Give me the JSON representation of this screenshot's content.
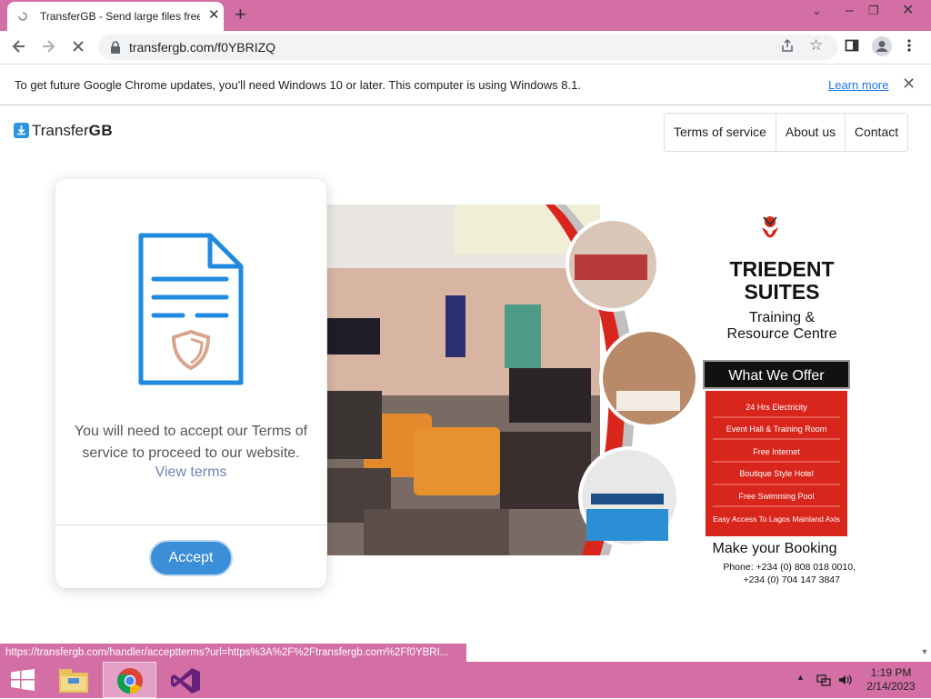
{
  "browser": {
    "tab_title": "TransferGB - Send large files free",
    "new_tab": "+",
    "url": "transfergb.com/f0YBRIZQ",
    "infobar_message": "To get future Google Chrome updates, you'll need Windows 10 or later. This computer is using Windows 8.1.",
    "infobar_link": "Learn more",
    "status_url": "https://transfergb.com/handler/acceptterms?url=https%3A%2F%2Ftransfergb.com%2Ff0YBRI..."
  },
  "site": {
    "logo_prefix": "Transfer",
    "logo_suffix": "GB",
    "nav": [
      "Terms of service",
      "About us",
      "Contact"
    ]
  },
  "terms_card": {
    "message": "You will need to accept our Terms of service to proceed to our website.",
    "view_link": "View terms",
    "accept_button": "Accept"
  },
  "ad": {
    "brand_line1": "TRIEDENT",
    "brand_line2": "SUITES",
    "subtitle_line1": "Training &",
    "subtitle_line2": "Resource Centre",
    "offer_title": "What We Offer",
    "offers": [
      "24 Hrs Electricity",
      "Event Hall & Training Room",
      "Free Internet",
      "Boutique Style Hotel",
      "Free Swimming Pool",
      "Easy Access To Lagos Mainland Axis"
    ],
    "booking_title": "Make your Booking",
    "phone_line1": "Phone: +234 (0) 808 018 0010,",
    "phone_line2": "+234 (0) 704 147 3847"
  },
  "taskbar": {
    "time": "1:19 PM",
    "date": "2/14/2023"
  },
  "colors": {
    "chrome_frame": "#d46fa6",
    "accent_blue": "#3b8ed8",
    "offer_red": "#d9261c"
  }
}
